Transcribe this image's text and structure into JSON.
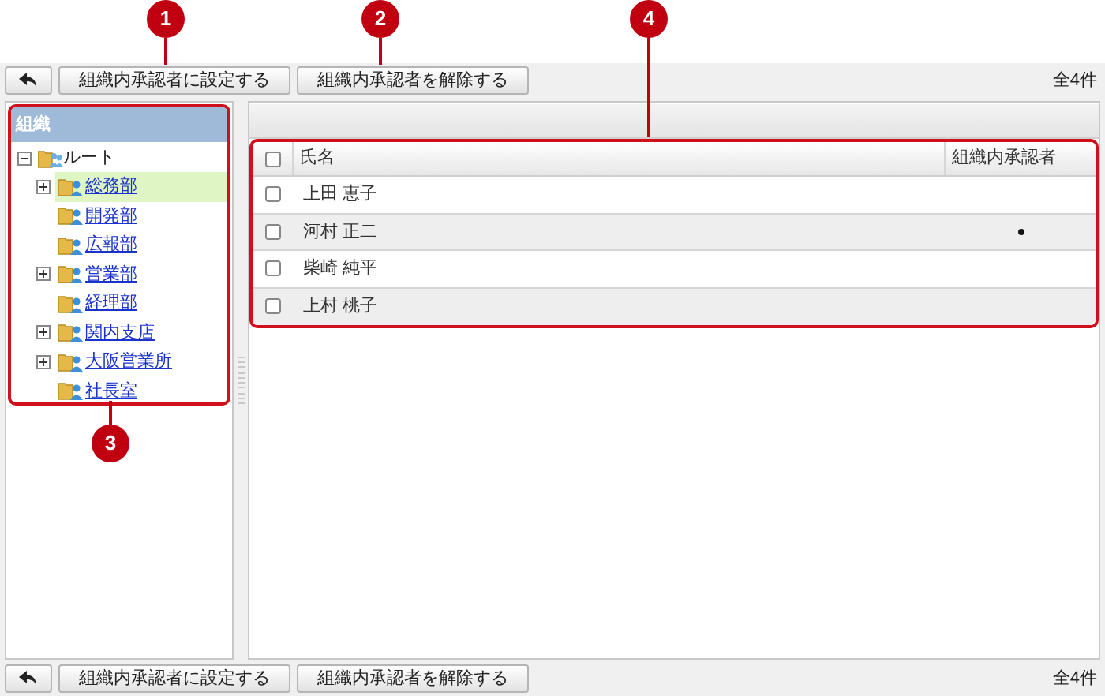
{
  "callouts": [
    {
      "number": "1"
    },
    {
      "number": "2"
    },
    {
      "number": "4"
    },
    {
      "number": "3"
    }
  ],
  "toolbar_top": {
    "buttons": [
      "組織内承認者に設定する",
      "組織内承認者を解除する"
    ],
    "count": "全4件"
  },
  "tree": {
    "title": "組織",
    "root": {
      "label": "ルート",
      "expanded": true,
      "children": [
        {
          "label": "総務部",
          "selected": true,
          "has_children": true,
          "expanded": false
        },
        {
          "label": "開発部",
          "selected": false,
          "has_children": false
        },
        {
          "label": "広報部",
          "selected": false,
          "has_children": false
        },
        {
          "label": "営業部",
          "selected": false,
          "has_children": true,
          "expanded": false
        },
        {
          "label": "経理部",
          "selected": false,
          "has_children": false
        },
        {
          "label": "関内支店",
          "selected": false,
          "has_children": true,
          "expanded": false
        },
        {
          "label": "大阪営業所",
          "selected": false,
          "has_children": true,
          "expanded": false
        },
        {
          "label": "社長室",
          "selected": false,
          "has_children": false
        }
      ]
    }
  },
  "table": {
    "columns": [
      "氏名",
      "組織内承認者"
    ],
    "all_checked": false,
    "rows": [
      {
        "name": "上田 恵子",
        "checked": false,
        "approver": false
      },
      {
        "name": "河村 正二",
        "checked": false,
        "approver": true
      },
      {
        "name": "柴崎 純平",
        "checked": false,
        "approver": false
      },
      {
        "name": "上村 桃子",
        "checked": false,
        "approver": false
      }
    ]
  },
  "toolbar_bottom": {
    "buttons": [
      "組織内承認者に設定する",
      "組織内承認者を解除する"
    ],
    "count": "全4件"
  }
}
